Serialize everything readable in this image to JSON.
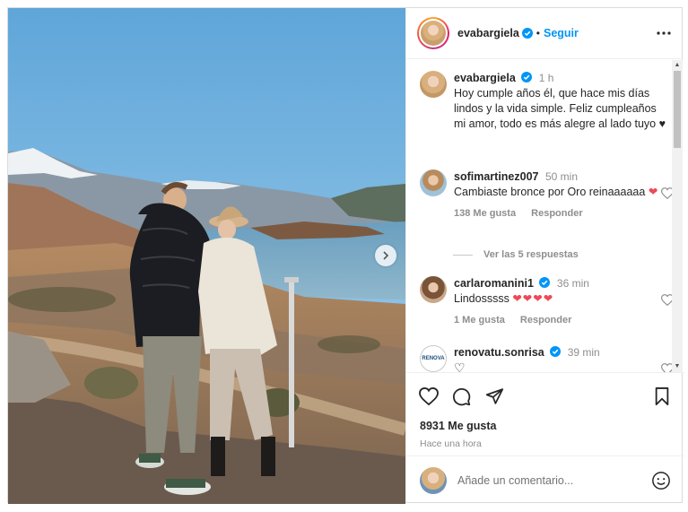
{
  "post": {
    "author": "evabargiela",
    "follow_label": "Seguir",
    "separator": "•",
    "caption": "Hoy cumple años él, que hace mis días lindos y la vida simple. Feliz cumpleaños mi amor, todo es más alegre al lado tuyo ♥",
    "caption_time": "1 h",
    "likes": "8931 Me gusta",
    "posted_ago": "Hace una hora",
    "comment_placeholder": "Añade un comentario..."
  },
  "comments": [
    {
      "user": "sofimartinez007",
      "time": "50 min",
      "text": "Cambiaste bronce por Oro reinaaaaaa",
      "emoji": "❤",
      "likes": "138 Me gusta",
      "reply": "Responder"
    },
    {
      "user": "carlaromanini1",
      "time": "36 min",
      "text": "Lindosssss",
      "emoji": "❤❤❤❤",
      "likes": "1 Me gusta",
      "reply": "Responder"
    },
    {
      "user": "renovatu.sonrisa",
      "time": "39 min",
      "emoji": "♡",
      "logo_text": "RENOVA"
    }
  ],
  "view_replies": "Ver las 5 respuestas",
  "icons": {
    "verified": "verified-badge-icon",
    "more": "more-options-icon",
    "like": "heart-icon",
    "comment": "comment-icon",
    "share": "send-icon",
    "save": "bookmark-icon",
    "emoji": "emoji-icon",
    "next": "chevron-right-icon"
  },
  "colors": {
    "link": "#0095f6",
    "verified": "#0095f6",
    "heart_emoji": "#ed4956",
    "muted": "#8e8e8e"
  }
}
